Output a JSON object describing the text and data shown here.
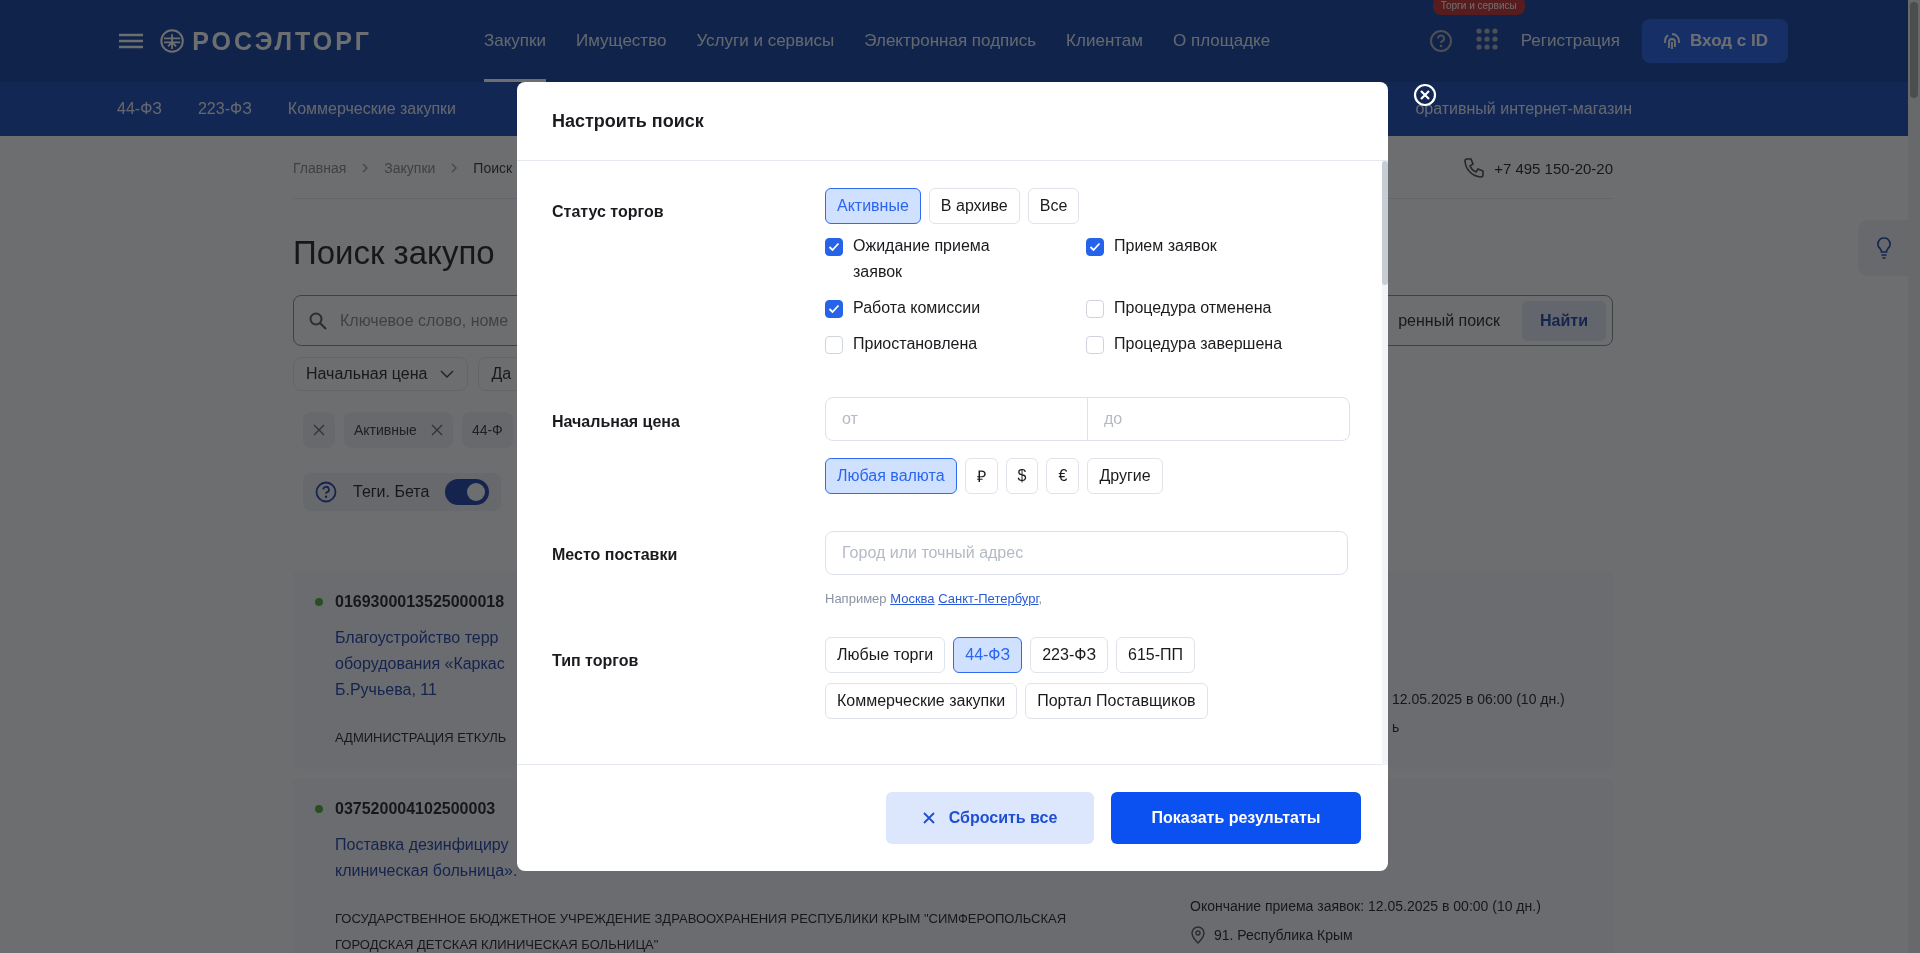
{
  "header": {
    "logo": "РОСЭЛТОРГ",
    "nav": [
      {
        "label": "Закупки",
        "selected": true
      },
      {
        "label": "Имущество",
        "selected": false
      },
      {
        "label": "Услуги и сервисы",
        "selected": false
      },
      {
        "label": "Электронная подпись",
        "selected": false
      },
      {
        "label": "Клиентам",
        "selected": false
      },
      {
        "label": "О площадке",
        "selected": false
      }
    ],
    "badge": "Торги и сервисы",
    "register": "Регистрация",
    "login": "Вход с ID"
  },
  "subnav": {
    "items": [
      "44-ФЗ",
      "223-ФЗ",
      "Коммерческие закупки"
    ],
    "right_item": "оративный интернет-магазин"
  },
  "breadcrumbs": [
    "Главная",
    "Закупки",
    "Поиск"
  ],
  "phone": "+7 495 150-20-20",
  "page_title": "Поиск закупо",
  "search": {
    "placeholder": "Ключевое слово, номе",
    "extended": "ренный поиск",
    "button": "Найти"
  },
  "filters": [
    "Начальная цена",
    "Да"
  ],
  "chips": [
    {
      "label": "Активные",
      "removable": true
    },
    {
      "label": "44-Ф",
      "removable": false
    }
  ],
  "tags_toggle": {
    "label": "Теги. Бета",
    "on": true
  },
  "results": [
    {
      "number": "0169300013525000018",
      "title_lines": [
        "Благоустройство терр",
        "оборудования «Каркас",
        "Б.Ручьева, 11"
      ],
      "customer": "АДМИНИСТРАЦИЯ ЕТКУЛЬ",
      "deadline": "12.05.2025 в 06:00 (10 дн.)",
      "location": "ь",
      "pin": false
    },
    {
      "number": "037520004102500003",
      "title_lines": [
        "Поставка дезинфициру",
        "клиническая больница»."
      ],
      "customer": "ГОСУДАРСТВЕННОЕ БЮДЖЕТНОЕ УЧРЕЖДЕНИЕ ЗДРАВООХРАНЕНИЯ РЕСПУБЛИКИ КРЫМ \"СИМФЕРОПОЛЬСКАЯ ГОРОДСКАЯ ДЕТСКАЯ КЛИНИЧЕСКАЯ БОЛЬНИЦА\"",
      "deadline": "Окончание приема заявок: 12.05.2025 в 00:00 (10 дн.)",
      "location": "91. Республика Крым",
      "pin": true
    }
  ],
  "modal": {
    "title": "Настроить поиск",
    "sections": [
      {
        "kind": "status",
        "label": "Статус торгов",
        "options": [
          {
            "label": "Активные",
            "selected": true
          },
          {
            "label": "В архиве",
            "selected": false
          },
          {
            "label": "Все",
            "selected": false
          }
        ],
        "checkboxes": [
          {
            "label": "Ожидание приема заявок",
            "checked": true
          },
          {
            "label": "Прием заявок",
            "checked": true
          },
          {
            "label": "Работа комиссии",
            "checked": true
          },
          {
            "label": "Процедура отменена",
            "checked": false
          },
          {
            "label": "Приостановлена",
            "checked": false
          },
          {
            "label": "Процедура завершена",
            "checked": false
          }
        ]
      },
      {
        "kind": "price",
        "label": "Начальная цена",
        "from_placeholder": "от",
        "to_placeholder": "до",
        "options": [
          {
            "label": "Любая валюта",
            "selected": true
          },
          {
            "label": "₽",
            "selected": false
          },
          {
            "label": "$",
            "selected": false
          },
          {
            "label": "€",
            "selected": false
          },
          {
            "label": "Другие",
            "selected": false
          }
        ]
      },
      {
        "kind": "place",
        "label": "Место поставки",
        "placeholder": "Город или точный адрес",
        "hint": "Например",
        "examples": [
          "Москва",
          "Санкт-Петербург"
        ],
        "hint_end": ","
      },
      {
        "kind": "type",
        "label": "Тип торгов",
        "options": [
          {
            "label": "Любые торги",
            "selected": false
          },
          {
            "label": "44-ФЗ",
            "selected": true
          },
          {
            "label": "223-ФЗ",
            "selected": false
          },
          {
            "label": "615-ПП",
            "selected": false
          },
          {
            "label": "Коммерческие закупки",
            "selected": false
          },
          {
            "label": "Портал Поставщиков",
            "selected": false
          }
        ]
      }
    ],
    "reset": "Сбросить все",
    "apply": "Показать результаты"
  }
}
